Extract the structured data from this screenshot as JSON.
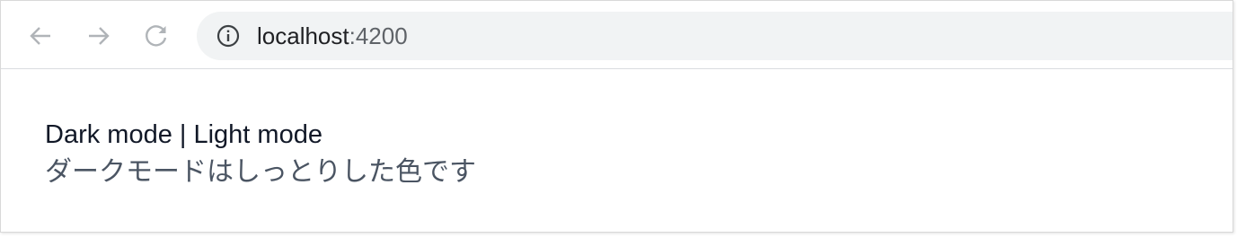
{
  "browser": {
    "url_host": "localhost",
    "url_port": ":4200",
    "icons": {
      "back": "arrow-left-icon",
      "forward": "arrow-right-icon",
      "reload": "reload-icon",
      "site_info": "info-icon"
    },
    "colors": {
      "omnibox_bg": "#f1f3f4",
      "icon_disabled": "#b0b4b8",
      "icon_active": "#5f6368"
    }
  },
  "page": {
    "mode_links": "Dark mode | Light mode",
    "description": "ダークモードはしっとりした色です",
    "colors": {
      "heading": "#111827",
      "description": "#4b5563"
    }
  }
}
